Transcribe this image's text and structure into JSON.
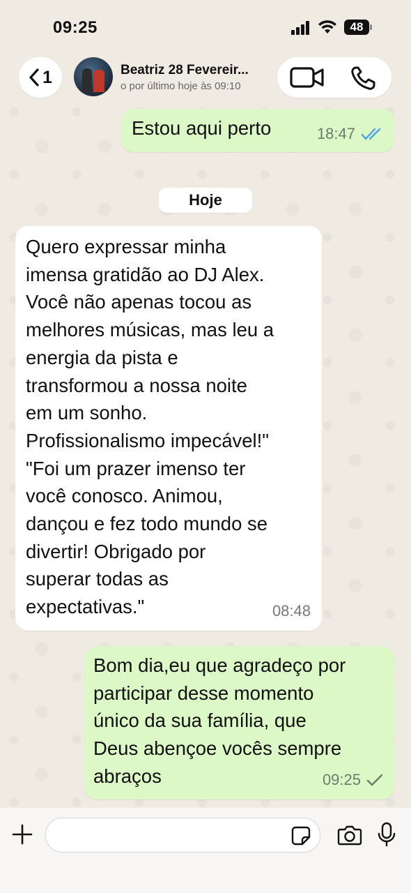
{
  "status_bar": {
    "time": "09:25",
    "battery": "48"
  },
  "header": {
    "back_count": "1",
    "contact_name": "Beatriz 28 Fevereir...",
    "contact_status": "o por último hoje às 09:10"
  },
  "messages": [
    {
      "direction": "outgoing",
      "text": "Estou aqui perto",
      "time": "18:47",
      "status": "read"
    },
    {
      "direction": "incoming",
      "text": "Quero expressar minha\nimensa gratidão ao DJ Alex.\nVocê não apenas tocou as\nmelhores músicas, mas leu a\nenergia da pista e\ntransformou a nossa noite\nem um sonho.\nProfissionalismo impecável!\"\n\"Foi um prazer imenso ter\nvocê conosco. Animou,\ndançou e fez todo mundo se\ndivertir! Obrigado por\nsuperar todas as\nexpectativas.\"",
      "time": "08:48"
    },
    {
      "direction": "outgoing",
      "text": "Bom dia,eu que agradeço por\nparticipar desse momento\núnico da sua família, que\nDeus abençoe vocês sempre\nabraços",
      "time": "09:25",
      "status": "sent"
    }
  ],
  "date_separator": "Hoje",
  "composer": {
    "placeholder": ""
  },
  "colors": {
    "outgoing_bubble": "#dbf8c6",
    "incoming_bubble": "#ffffff",
    "read_ticks": "#4fa3e0",
    "background": "#efeae2"
  },
  "icons": [
    "back-chevron-icon",
    "video-call-icon",
    "phone-icon",
    "double-check-icon",
    "single-check-icon",
    "plus-icon",
    "sticker-icon",
    "camera-icon",
    "microphone-icon"
  ]
}
